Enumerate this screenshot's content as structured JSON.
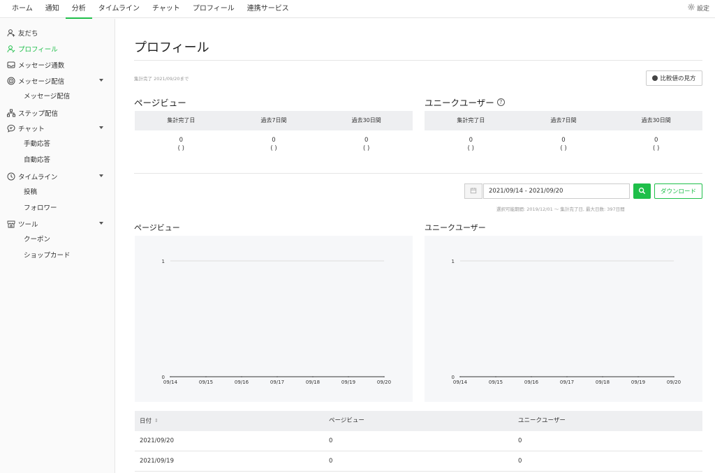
{
  "topnav": {
    "tabs": [
      {
        "label": "ホーム",
        "active": false
      },
      {
        "label": "通知",
        "active": false
      },
      {
        "label": "分析",
        "active": true
      },
      {
        "label": "タイムライン",
        "active": false
      },
      {
        "label": "チャット",
        "active": false
      },
      {
        "label": "プロフィール",
        "active": false
      },
      {
        "label": "連携サービス",
        "active": false
      }
    ],
    "settings_label": "設定",
    "accent_color": "#1fbf4a"
  },
  "sidebar": {
    "items": [
      {
        "label": "友だち",
        "icon": "person-add-icon",
        "active": false
      },
      {
        "label": "プロフィール",
        "icon": "profile-icon",
        "active": true
      },
      {
        "label": "メッセージ通数",
        "icon": "inbox-icon",
        "active": false
      },
      {
        "label": "メッセージ配信",
        "icon": "broadcast-icon",
        "active": false,
        "expanded": true
      },
      {
        "label": "メッセージ配信",
        "sub": true
      },
      {
        "label": "ステップ配信",
        "icon": "step-icon",
        "active": false
      },
      {
        "label": "チャット",
        "icon": "chat-icon",
        "active": false,
        "expanded": true
      },
      {
        "label": "手動応答",
        "sub": true
      },
      {
        "label": "自動応答",
        "sub": true
      },
      {
        "label": "タイムライン",
        "icon": "clock-icon",
        "active": false,
        "expanded": true
      },
      {
        "label": "投稿",
        "sub": true
      },
      {
        "label": "フォロワー",
        "sub": true
      },
      {
        "label": "ツール",
        "icon": "shop-icon",
        "active": false,
        "expanded": true
      },
      {
        "label": "クーポン",
        "sub": true
      },
      {
        "label": "ショップカード",
        "sub": true
      }
    ]
  },
  "main": {
    "title": "プロフィール",
    "as_of": "集計完了 2021/09/20まで",
    "compare_button": "比較値の見方",
    "pageview": {
      "title": "ページビュー",
      "headers": [
        "集計完了日",
        "過去7日間",
        "過去30日間"
      ],
      "values": [
        "0",
        "0",
        "0"
      ],
      "sub_values": [
        "( )",
        "( )",
        "( )"
      ]
    },
    "unique_users": {
      "title": "ユニークユーザー",
      "headers": [
        "集計完了日",
        "過去7日間",
        "過去30日間"
      ],
      "values": [
        "0",
        "0",
        "0"
      ],
      "sub_values": [
        "( )",
        "( )",
        "( )"
      ]
    },
    "date_range": {
      "value": "2021/09/14 - 2021/09/20",
      "download_label": "ダウンロード",
      "note": "選択可能期間: 2019/12/01 〜 集計完了日, 最大日数: 397日間"
    },
    "table": {
      "headers": [
        "日付",
        "ページビュー",
        "ユニークユーザー"
      ],
      "rows": [
        [
          "2021/09/20",
          "0",
          "0"
        ],
        [
          "2021/09/19",
          "0",
          "0"
        ]
      ]
    }
  },
  "chart_data": [
    {
      "type": "line",
      "title": "ページビュー",
      "categories": [
        "09/14",
        "09/15",
        "09/16",
        "09/17",
        "09/18",
        "09/19",
        "09/20"
      ],
      "series": [
        {
          "values": [
            0,
            0,
            0,
            0,
            0,
            0,
            0
          ]
        }
      ],
      "ylim": [
        0,
        1
      ],
      "yticks": [
        "0",
        "1"
      ],
      "grid": true
    },
    {
      "type": "line",
      "title": "ユニークユーザー",
      "categories": [
        "09/14",
        "09/15",
        "09/16",
        "09/17",
        "09/18",
        "09/19",
        "09/20"
      ],
      "series": [
        {
          "values": [
            0,
            0,
            0,
            0,
            0,
            0,
            0
          ]
        }
      ],
      "ylim": [
        0,
        1
      ],
      "yticks": [
        "0",
        "1"
      ],
      "grid": true
    }
  ]
}
